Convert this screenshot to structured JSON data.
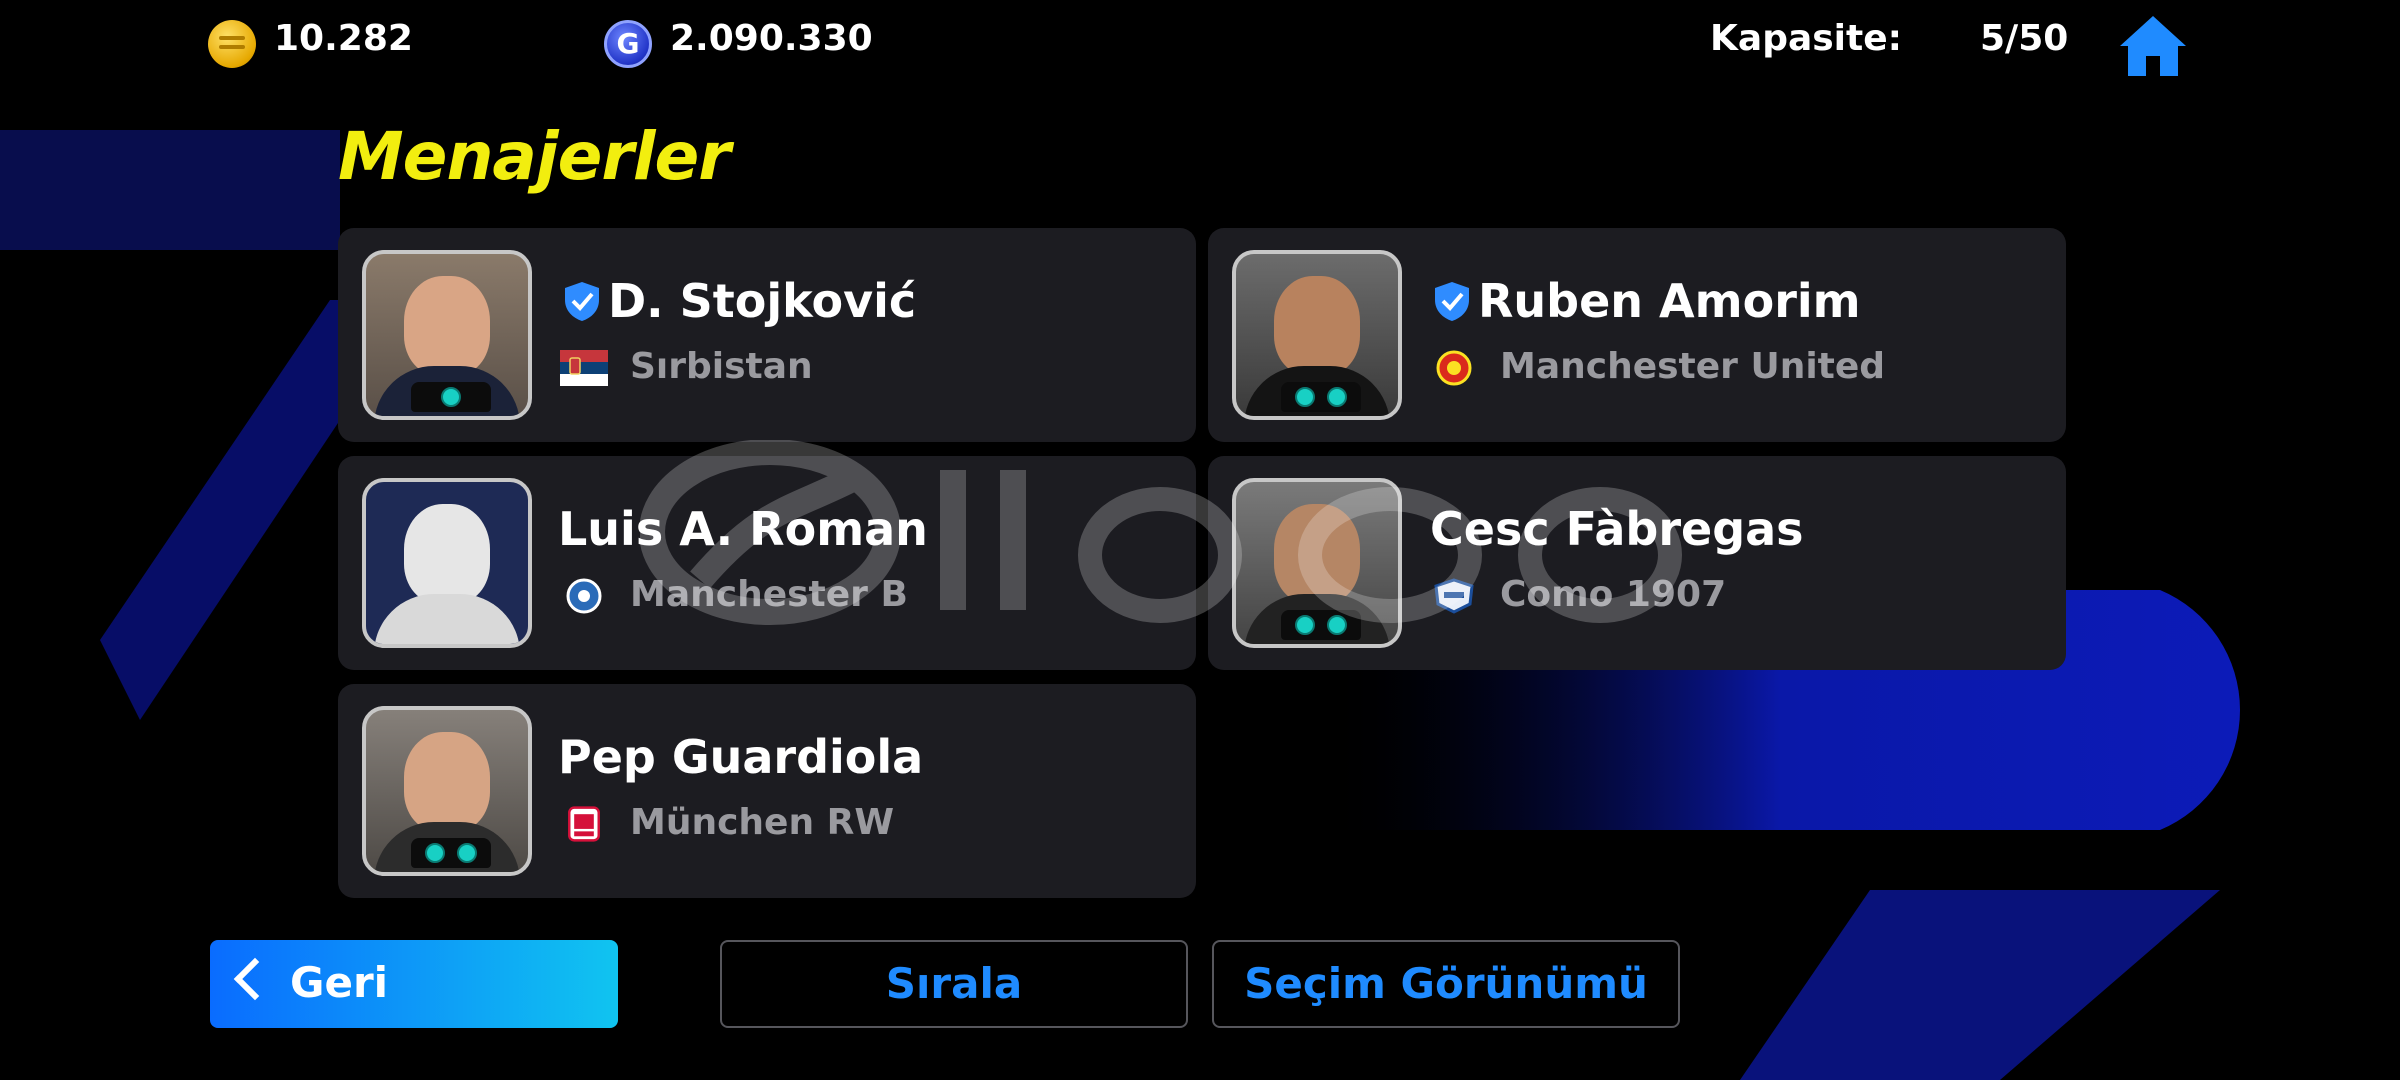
{
  "currency": {
    "coins": "10.282",
    "gp_symbol": "G",
    "gp": "2.090.330"
  },
  "capacity": {
    "label": "Kapasite:",
    "value": "5/50"
  },
  "page_title": "Menajerler",
  "managers": [
    {
      "name": "D. Stojković",
      "team": "Sırbistan",
      "verified": true
    },
    {
      "name": "Ruben Amorim",
      "team": "Manchester United",
      "verified": true
    },
    {
      "name": "Luis A. Roman",
      "team": "Manchester B",
      "verified": false
    },
    {
      "name": "Cesc Fàbregas",
      "team": "Como 1907",
      "verified": false
    },
    {
      "name": "Pep Guardiola",
      "team": "München RW",
      "verified": false
    }
  ],
  "buttons": {
    "back": "Geri",
    "sort": "Sırala",
    "selection_view": "Seçim Görünümü"
  },
  "icons": {
    "coin": "ecoin-icon",
    "gp": "gp-icon",
    "home": "home-icon",
    "verified": "verified-shield-icon"
  },
  "colors": {
    "title": "#f2ee0f",
    "accent": "#1f8bff",
    "card_bg": "#1c1c21"
  }
}
